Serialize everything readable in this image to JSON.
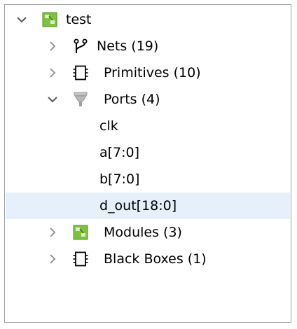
{
  "tree": {
    "root": {
      "label": "test",
      "icon": "module-icon",
      "expanded": true
    },
    "nets": {
      "label": "Nets (19)",
      "icon": "net-branch-icon",
      "expanded": false
    },
    "primitives": {
      "label": "Primitives (10)",
      "icon": "primitive-chip-icon",
      "expanded": false
    },
    "ports": {
      "label": "Ports (4)",
      "icon": "port-funnel-icon",
      "expanded": true,
      "children": [
        {
          "label": "clk"
        },
        {
          "label": "a[7:0]"
        },
        {
          "label": "b[7:0]"
        },
        {
          "label": "d_out[18:0]",
          "selected": true
        }
      ]
    },
    "modules": {
      "label": "Modules (3)",
      "icon": "module-icon",
      "expanded": false
    },
    "black_boxes": {
      "label": "Black Boxes (1)",
      "icon": "primitive-chip-icon",
      "expanded": false
    }
  },
  "colors": {
    "selection": "#e6f0fb",
    "module_icon_green": "#7fc241",
    "twisty": "#5a5a5a",
    "border": "#a0a0a0"
  }
}
